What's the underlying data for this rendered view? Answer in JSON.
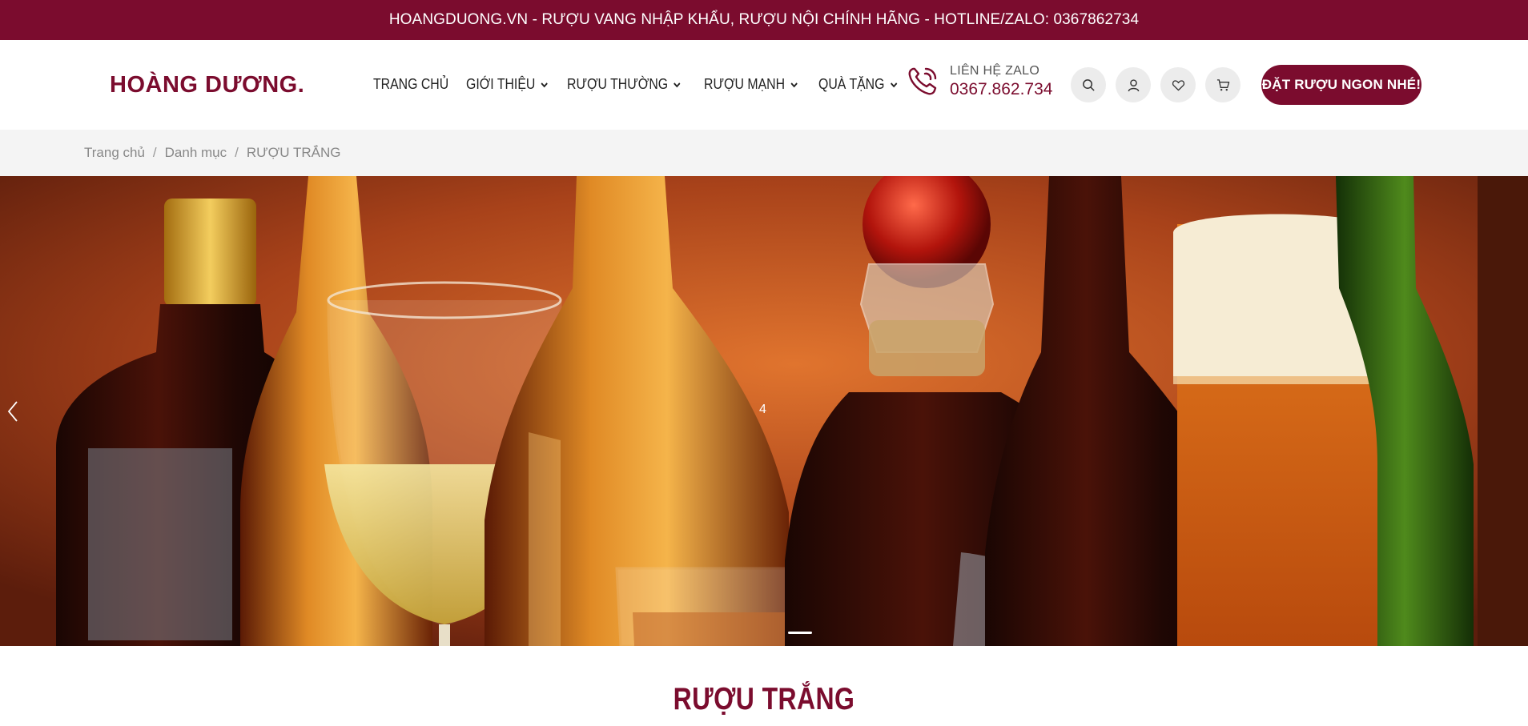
{
  "topbar": {
    "text": "HOANGDUONG.VN - RƯỢU VANG NHẬP KHẨU, RƯỢU NỘI CHÍNH HÃNG - HOTLINE/ZALO: 0367862734"
  },
  "header": {
    "logo": "HOÀNG DƯƠNG.",
    "nav": [
      {
        "label": "TRANG CHỦ",
        "has_dropdown": false
      },
      {
        "label": "GIỚI THIỆU",
        "has_dropdown": true
      },
      {
        "label": "RƯỢU THƯỜNG",
        "has_dropdown": true
      },
      {
        "label": "RƯỢU MẠNH",
        "has_dropdown": true
      },
      {
        "label": "QUÀ TẶNG",
        "has_dropdown": true
      }
    ],
    "zalo": {
      "label": "LIÊN HỆ ZALO",
      "number": "0367.862.734",
      "icon": "phone-icon"
    },
    "icons": [
      "search-icon",
      "user-icon",
      "heart-icon",
      "cart-icon"
    ],
    "cta": "ĐẶT RƯỢU NGON NHÉ!"
  },
  "breadcrumb": {
    "items": [
      "Trang chủ",
      "Danh mục",
      "RƯỢU TRẮNG"
    ],
    "separator": "/"
  },
  "hero": {
    "slide_number": "4",
    "image": "liquor-bottles-banner"
  },
  "section": {
    "title": "RƯỢU TRẮNG"
  },
  "colors": {
    "brand": "#7b0c2e",
    "breadcrumb_bg": "#f4f4f4",
    "icon_bg": "#ececec"
  }
}
